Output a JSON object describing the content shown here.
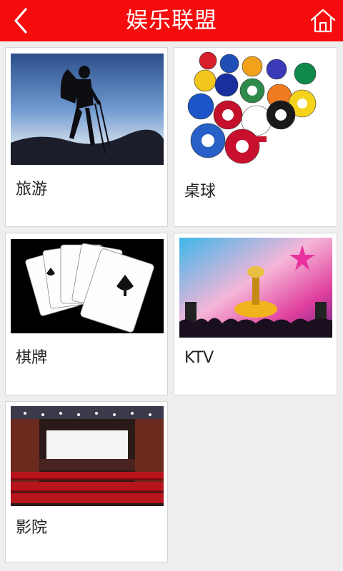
{
  "header": {
    "title": "娱乐联盟",
    "back_icon": "chevron-left-icon",
    "home_icon": "home-icon",
    "color": "#f60c0c"
  },
  "categories": [
    {
      "label": "旅游"
    },
    {
      "label": "桌球"
    },
    {
      "label": "棋牌"
    },
    {
      "label": "KTV"
    },
    {
      "label": "影院"
    }
  ]
}
